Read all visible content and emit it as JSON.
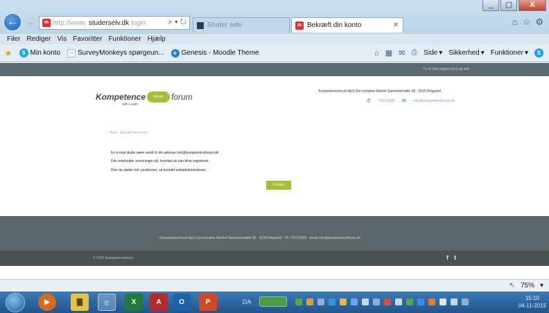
{
  "browser": {
    "window_controls": {
      "minimize": "_",
      "maximize": "▢",
      "close": "X"
    },
    "address": {
      "favicon": "m",
      "url": "studerselv.dk",
      "url_blurred": "http://www.",
      "url_tail": "login",
      "search": "⌕",
      "dropdown": "▾",
      "refresh": "↻"
    },
    "tabs": [
      {
        "label": "Studer selv",
        "close": "",
        "favicon": ""
      },
      {
        "label": "Bekræft din konto",
        "close": "✕",
        "favicon": "m"
      }
    ],
    "right_tools": [
      "⌂",
      "☆",
      "⚙"
    ],
    "menu": [
      "Filer",
      "Rediger",
      "Vis",
      "Favoritter",
      "Funktioner",
      "Hjælp"
    ],
    "favorites": [
      {
        "label": "Min konto",
        "icon": "skype-icon",
        "glyph": "S"
      },
      {
        "label": "SurveyMonkeys spørgeun...",
        "icon": "survey-icon",
        "glyph": "~"
      },
      {
        "label": "Genesis - Moodle Theme",
        "icon": "ie-icon",
        "glyph": "e"
      }
    ],
    "commands": [
      {
        "label": "Side",
        "icon": "page-icon"
      },
      {
        "label": "Sikkerhed",
        "icon": "shield-icon"
      },
      {
        "label": "Funktioner",
        "icon": "tools-icon"
      }
    ],
    "command_icons": [
      "⌂",
      "▦",
      "✉",
      "⎙"
    ],
    "zoom": "75%"
  },
  "page": {
    "login_note": "Du er ikke logget ind (Log ind)",
    "logo": {
      "part1": "Kompetence",
      "badge": "forum",
      "part2": "forum",
      "sub": "with Learn"
    },
    "contact_address": "Kompetenceforum ApS  Den kreative Markel  Gammelsmølle 38  ·  4100 Ringsted",
    "contact_phone": "7023 6090",
    "contact_email": "info@kompetenceforum.dk",
    "breadcrumb": "⌂ Hjem  ·  Bekræft din konto",
    "messages": [
      "En e-mail skulle være sendt til din adresse info@kompetenceforum.dk",
      "Den indeholder anvisninger på, hvordan du kan blive registreret.",
      "Hvis du støder ind i problemer, så kontakt webadministratoren."
    ],
    "continue_button": "Fortsæt",
    "footer_text": "Kompetenceforum ApS  Den kreative Markel  Gammelsmølle 38  ·  4100 Ringsted  ·  Tlf. 7023 6090  ·  email info@kompetenceforum.dk",
    "copyright": "© 2015 Kompetenceforum",
    "social": [
      "f",
      "t"
    ]
  },
  "taskbar": {
    "language": "DA",
    "apps": [
      {
        "name": "media-player",
        "label": "▶"
      },
      {
        "name": "file-explorer",
        "label": "▇"
      },
      {
        "name": "internet-explorer",
        "label": "e"
      },
      {
        "name": "excel",
        "label": "X"
      },
      {
        "name": "access",
        "label": "A"
      },
      {
        "name": "outlook",
        "label": "O"
      },
      {
        "name": "powerpoint",
        "label": "P"
      }
    ],
    "time": "15:10",
    "date": "04-11-2015"
  },
  "colors": {
    "accent_green": "#a9be35",
    "header_gray": "#5c6a6f",
    "footer_gray": "#5c6567"
  }
}
